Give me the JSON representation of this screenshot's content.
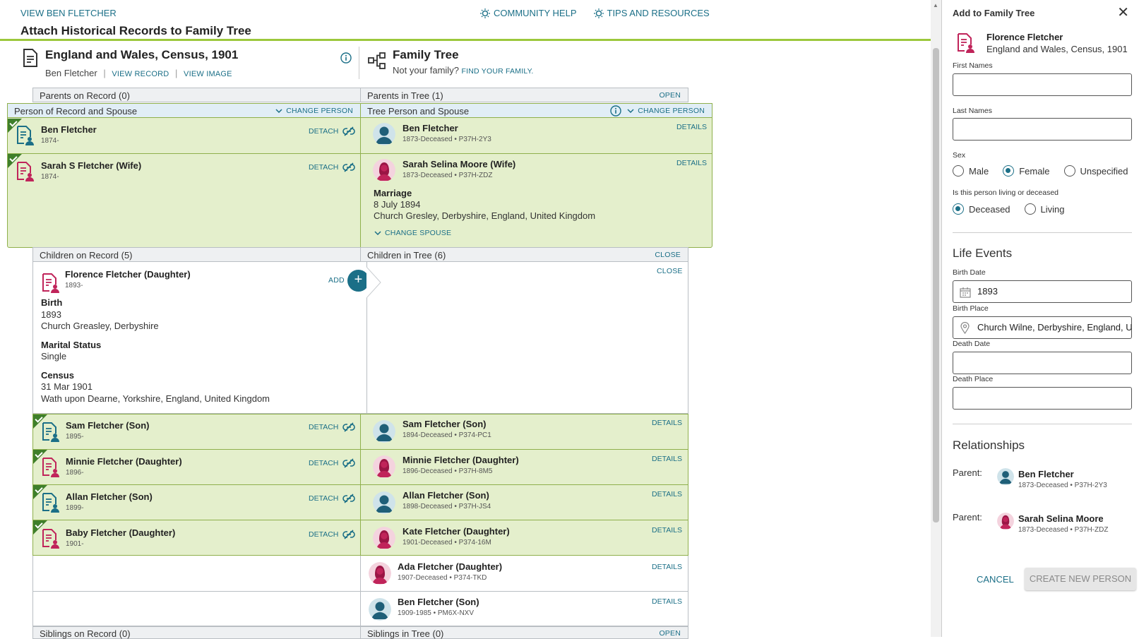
{
  "topbar": {
    "view_link": "VIEW BEN FLETCHER",
    "community_help": "COMMUNITY HELP",
    "tips": "TIPS AND RESOURCES",
    "page_title": "Attach Historical Records to Family Tree"
  },
  "record": {
    "title": "England and Wales, Census, 1901",
    "person": "Ben Fletcher",
    "view_record": "VIEW RECORD",
    "view_image": "VIEW IMAGE"
  },
  "tree": {
    "title": "Family Tree",
    "not_family": "Not your family?",
    "find_family": "FIND YOUR FAMILY."
  },
  "sections": {
    "parents_record": "Parents on Record (0)",
    "parents_tree": "Parents in Tree (1)",
    "parents_open": "OPEN",
    "person_spouse_record": "Person of Record and Spouse",
    "person_spouse_tree": "Tree Person and Spouse",
    "change_person": "CHANGE PERSON",
    "children_record": "Children on Record (5)",
    "children_tree": "Children in Tree (6)",
    "close": "CLOSE",
    "siblings_record": "Siblings on Record (0)",
    "siblings_tree": "Siblings in Tree (0)",
    "siblings_open": "OPEN"
  },
  "labels": {
    "detach": "DETACH",
    "details": "DETAILS",
    "add": "ADD",
    "change_spouse": "CHANGE SPOUSE"
  },
  "couple": {
    "record_1": {
      "name": "Ben Fletcher",
      "sub": "1874-"
    },
    "record_2": {
      "name": "Sarah S Fletcher (Wife)",
      "sub": "1874-"
    },
    "tree_1": {
      "name": "Ben Fletcher",
      "sub": "1873-Deceased • P37H-2Y3"
    },
    "tree_2": {
      "name": "Sarah Selina Moore (Wife)",
      "sub": "1873-Deceased • P37H-ZDZ"
    },
    "marriage_label": "Marriage",
    "marriage_date": "8 July 1894",
    "marriage_place": "Church Gresley, Derbyshire, England, United Kingdom"
  },
  "florence": {
    "name": "Florence Fletcher (Daughter)",
    "sub": "1893-",
    "birth_label": "Birth",
    "birth_year": "1893",
    "birth_place": "Church Greasley, Derbyshire",
    "marital_label": "Marital Status",
    "marital_value": "Single",
    "census_label": "Census",
    "census_date": "31 Mar 1901",
    "census_place": "Wath upon Dearne, Yorkshire, England, United Kingdom"
  },
  "children": [
    {
      "rec_name": "Sam Fletcher (Son)",
      "rec_sub": "1895-",
      "tree_name": "Sam Fletcher (Son)",
      "tree_sub": "1894-Deceased • P374-PC1"
    },
    {
      "rec_name": "Minnie Fletcher (Daughter)",
      "rec_sub": "1896-",
      "tree_name": "Minnie Fletcher (Daughter)",
      "tree_sub": "1896-Deceased • P37H-8M5"
    },
    {
      "rec_name": "Allan Fletcher (Son)",
      "rec_sub": "1899-",
      "tree_name": "Allan Fletcher (Son)",
      "tree_sub": "1898-Deceased • P37H-JS4"
    },
    {
      "rec_name": "Baby Fletcher (Daughter)",
      "rec_sub": "1901-",
      "tree_name": "Kate Fletcher (Daughter)",
      "tree_sub": "1901-Deceased • P374-16M"
    }
  ],
  "extra_children": [
    {
      "name": "Ada Fletcher (Daughter)",
      "sub": "1907-Deceased • P374-TKD"
    },
    {
      "name": "Ben Fletcher (Son)",
      "sub": "1909-1985 • PM6X-NXV"
    }
  ],
  "panel": {
    "title": "Add to Family Tree",
    "person_name": "Florence Fletcher",
    "person_source": "England and Wales, Census, 1901",
    "first_names_label": "First Names",
    "first_names_value": "",
    "last_names_label": "Last Names",
    "last_names_value": "",
    "sex_label": "Sex",
    "sex_options": [
      "Male",
      "Female",
      "Unspecified"
    ],
    "sex_selected": "Female",
    "living_label": "Is this person living or deceased",
    "living_options": [
      "Deceased",
      "Living"
    ],
    "living_selected": "Deceased",
    "life_events": "Life Events",
    "birth_date_label": "Birth Date",
    "birth_date_value": "1893",
    "birth_place_label": "Birth Place",
    "birth_place_value": "Church Wilne, Derbyshire, England, U",
    "death_date_label": "Death Date",
    "death_place_label": "Death Place",
    "relationships": "Relationships",
    "parent_label": "Parent:",
    "parents": [
      {
        "name": "Ben Fletcher",
        "sub": "1873-Deceased • P37H-2Y3"
      },
      {
        "name": "Sarah Selina Moore",
        "sub": "1873-Deceased • P37H-ZDZ"
      }
    ],
    "cancel": "CANCEL",
    "create": "CREATE NEW PERSON"
  },
  "colors": {
    "accent": "#1b6f87",
    "green_bg": "#e4efcc",
    "green_border": "#8fb04c",
    "female": "#c0245a",
    "check": "#3f7f2b",
    "lime": "#9cc83c"
  }
}
